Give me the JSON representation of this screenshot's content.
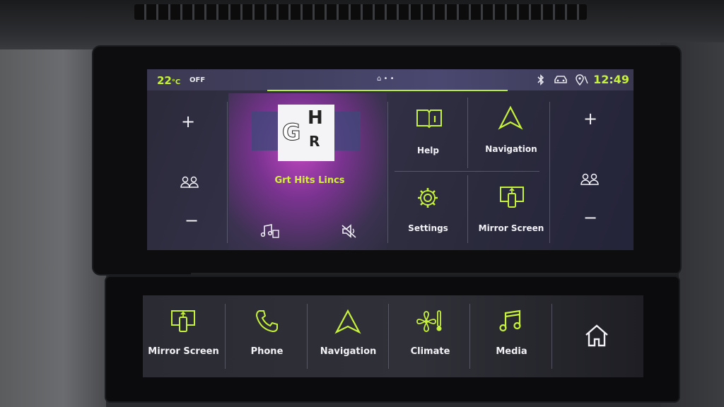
{
  "status": {
    "temperature": "22",
    "temperature_unit": "°C",
    "fan_state": "OFF",
    "page_dots": "⌂ • •",
    "time": "12:49"
  },
  "left_controls": {
    "plus": "+",
    "minus": "−"
  },
  "right_controls": {
    "plus": "+",
    "minus": "−"
  },
  "media": {
    "station_name": "Grt Hits Lincs",
    "logo_letters": {
      "g": "G",
      "h": "H",
      "r": "R"
    }
  },
  "tiles": {
    "help": "Help",
    "navigation": "Navigation",
    "settings": "Settings",
    "mirror_screen": "Mirror Screen"
  },
  "bottom_bar": {
    "mirror_screen": "Mirror Screen",
    "phone": "Phone",
    "navigation": "Navigation",
    "climate": "Climate",
    "media": "Media"
  },
  "colors": {
    "accent": "#c7f23a",
    "text": "#f2f2f6",
    "background": "#2d2c3e"
  },
  "icons": [
    "bluetooth-icon",
    "car-icon",
    "location-icon",
    "help-icon",
    "navigation-icon",
    "settings-icon",
    "mirror-screen-icon",
    "phone-icon",
    "climate-icon",
    "media-icon",
    "home-icon",
    "profile-icon",
    "music-source-icon",
    "mute-icon"
  ]
}
